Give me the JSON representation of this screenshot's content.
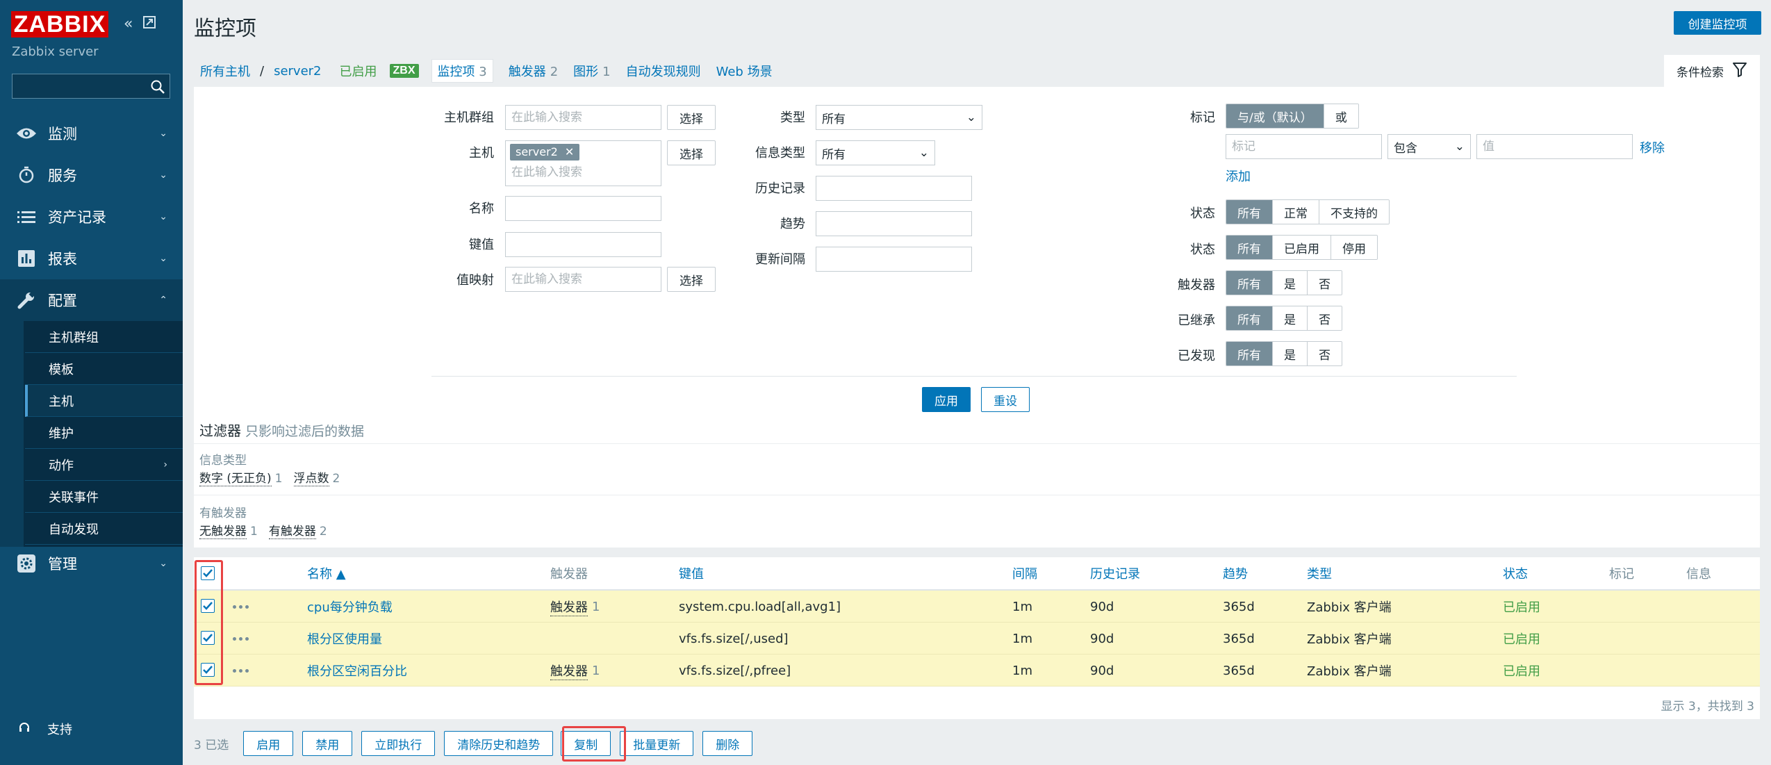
{
  "sidebar": {
    "logo": "ZABBIX",
    "server": "Zabbix server",
    "menu": [
      {
        "label": "监测",
        "icon": "eye-icon"
      },
      {
        "label": "服务",
        "icon": "clock-icon"
      },
      {
        "label": "资产记录",
        "icon": "list-icon"
      },
      {
        "label": "报表",
        "icon": "bar-chart-icon"
      },
      {
        "label": "配置",
        "icon": "wrench-icon"
      },
      {
        "label": "管理",
        "icon": "gear-icon"
      }
    ],
    "submenu": [
      "主机群组",
      "模板",
      "主机",
      "维护",
      "动作",
      "关联事件",
      "自动发现"
    ],
    "support": "支持"
  },
  "header": {
    "title": "监控项",
    "create_button": "创建监控项"
  },
  "breadcrumb": {
    "all_hosts": "所有主机",
    "host": "server2",
    "enabled": "已启用",
    "zbx": "ZBX",
    "items_label": "监控项",
    "items_count": "3",
    "triggers_label": "触发器",
    "triggers_count": "2",
    "graphs_label": "图形",
    "graphs_count": "1",
    "discovery": "自动发现规则",
    "web": "Web 场景"
  },
  "filter_tab": "条件检索",
  "filter": {
    "host_group_label": "主机群组",
    "host_group_placeholder": "在此输入搜索",
    "select": "选择",
    "host_label": "主机",
    "host_chip": "server2",
    "host_placeholder": "在此输入搜索",
    "name_label": "名称",
    "key_label": "键值",
    "valuemap_label": "值映射",
    "valuemap_placeholder": "在此输入搜索",
    "type_label": "类型",
    "type_value": "所有",
    "info_type_label": "信息类型",
    "info_type_value": "所有",
    "history_label": "历史记录",
    "trends_label": "趋势",
    "interval_label": "更新间隔",
    "tags_label": "标记",
    "tags_mode": [
      "与/或（默认）",
      "或"
    ],
    "tag_placeholder": "标记",
    "tag_op": "包含",
    "tag_value_placeholder": "值",
    "remove": "移除",
    "add": "添加",
    "state_label": "状态",
    "state_options": [
      "所有",
      "正常",
      "不支持的"
    ],
    "status_label": "状态",
    "status_options": [
      "所有",
      "已启用",
      "停用"
    ],
    "triggers_label": "触发器",
    "inherited_label": "已继承",
    "discovered_label": "已发现",
    "yes_no": [
      "所有",
      "是",
      "否"
    ],
    "apply": "应用",
    "reset": "重设"
  },
  "subfilter": {
    "title": "过滤器",
    "subtitle": "只影响过滤后的数据",
    "groups": [
      {
        "label": "信息类型",
        "values": [
          {
            "name": "数字 (无正负)",
            "count": "1"
          },
          {
            "name": "浮点数",
            "count": "2"
          }
        ]
      },
      {
        "label": "有触发器",
        "values": [
          {
            "name": "无触发器",
            "count": "1"
          },
          {
            "name": "有触发器",
            "count": "2"
          }
        ]
      }
    ]
  },
  "table": {
    "columns": {
      "name": "名称 ▲",
      "triggers": "触发器",
      "key": "键值",
      "interval": "间隔",
      "history": "历史记录",
      "trends": "趋势",
      "type": "类型",
      "status": "状态",
      "tags": "标记",
      "info": "信息"
    },
    "rows": [
      {
        "name": "cpu每分钟负载",
        "triggers": "触发器",
        "triggers_count": "1",
        "key": "system.cpu.load[all,avg1]",
        "interval": "1m",
        "history": "90d",
        "trends": "365d",
        "type": "Zabbix 客户端",
        "status": "已启用"
      },
      {
        "name": "根分区使用量",
        "triggers": "",
        "triggers_count": "",
        "key": "vfs.fs.size[/,used]",
        "interval": "1m",
        "history": "90d",
        "trends": "365d",
        "type": "Zabbix 客户端",
        "status": "已启用"
      },
      {
        "name": "根分区空闲百分比",
        "triggers": "触发器",
        "triggers_count": "1",
        "key": "vfs.fs.size[/,pfree]",
        "interval": "1m",
        "history": "90d",
        "trends": "365d",
        "type": "Zabbix 客户端",
        "status": "已启用"
      }
    ],
    "footer": "显示 3，共找到 3"
  },
  "actions": {
    "selected": "3 已选",
    "buttons": [
      "启用",
      "禁用",
      "立即执行",
      "清除历史和趋势",
      "复制",
      "批量更新",
      "删除"
    ]
  },
  "colors": {
    "sidebar": "#0e4d70",
    "accent": "#0275b8",
    "enabled": "#429e47",
    "highlight": "#e84343",
    "row_selected": "#fbf7c6"
  }
}
